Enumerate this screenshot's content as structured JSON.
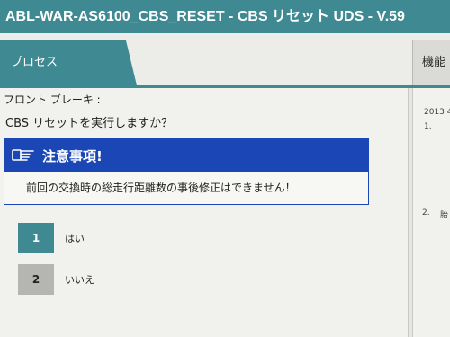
{
  "window": {
    "title": "ABL-WAR-AS6100_CBS_RESET - CBS リセット UDS - V.59"
  },
  "tabs": {
    "process": "プロセス",
    "function": "機能 :"
  },
  "main": {
    "line1": "フロント ブレーキ :",
    "line2": "CBS リセットを実行しますか？",
    "caution": {
      "title": "注意事項!",
      "icon": "pointing-hand-icon",
      "body": "前回の交換時の総走行距離数の事後修正はできません！"
    },
    "options": [
      {
        "number": "1",
        "label": "はい"
      },
      {
        "number": "2",
        "label": "いいえ"
      }
    ]
  },
  "right_panel": {
    "date": "2013 4",
    "item1": "1.",
    "item2": "2.",
    "item2_text": "胎"
  },
  "colors": {
    "teal": "#3f8a92",
    "caution_blue": "#1a47b5",
    "option_gray": "#b5b5b2"
  }
}
